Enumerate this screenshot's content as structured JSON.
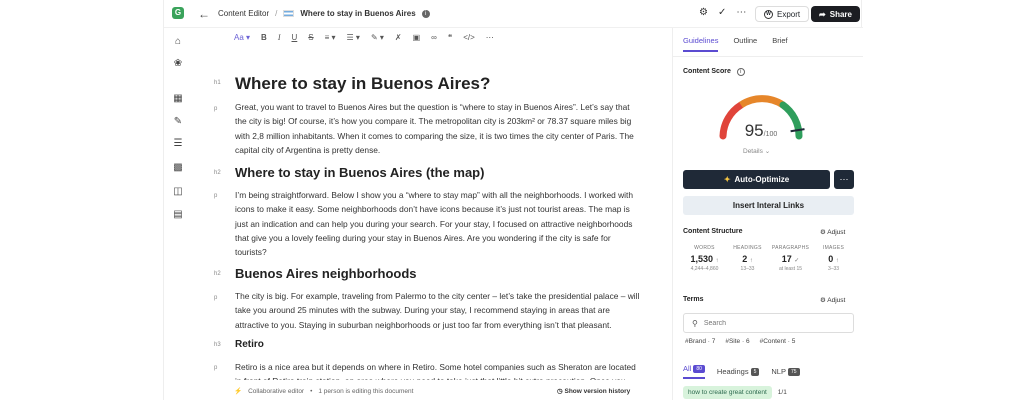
{
  "topbar": {
    "logo": "G",
    "breadcrumb_parent": "Content Editor",
    "breadcrumb_sep": "/",
    "doc_title": "Where to stay in Buenos Aires",
    "export_label": "Export",
    "share_label": "Share"
  },
  "toolbar": {
    "font_label": "Aa"
  },
  "editor": {
    "blocks": [
      {
        "tag": "h1",
        "text": "Where to stay in Buenos Aires?"
      },
      {
        "tag": "p",
        "text": "Great, you want to travel to Buenos Aires but the question is “where to stay in Buenos Aires”. Let’s say that the city is big! Of course, it’s how you compare it. The metropolitan city is 203km² or 78.37 square miles big with 2,8 million inhabitants. When it comes to comparing the size, it is two times the city center of Paris. The capital city of Argentina is pretty dense."
      },
      {
        "tag": "h2",
        "text": "Where to stay in Buenos Aires (the map)"
      },
      {
        "tag": "p",
        "text": "I’m being straightforward. Below I show you a “where to stay map” with all the neighborhoods. I worked with icons to make it easy. Some neighborhoods don’t have icons because it’s just not tourist areas. The map is just an indication and can help you during your search. For your stay, I focused on attractive neighborhoods that give you a lovely feeling during your stay in Buenos Aires. Are you wondering if the city is safe for tourists?"
      },
      {
        "tag": "h2",
        "text": "Buenos Aires neighborhoods"
      },
      {
        "tag": "p",
        "text": "The city is big. For example, traveling from Palermo to the city center – let’s take the presidential palace – will take you around 25 minutes with the subway. During your stay, I recommend staying in areas that are attractive to you. Staying in suburban neighborhoods or just too far from everything isn’t that pleasant."
      },
      {
        "tag": "h3",
        "text": "Retiro"
      },
      {
        "tag": "p",
        "text": "Retiro is a nice area but it depends on where in Retiro. Some hotel companies such as Sheraton are located in front of Retiro train station, an area where you need to take just that little bit extra precaution. Once you"
      }
    ],
    "status_left": "Collaborative editor",
    "status_dot": "•",
    "status_editing": "1 person is editing this document",
    "version_history": "Show version history"
  },
  "panel": {
    "tabs": [
      "Guidelines",
      "Outline",
      "Brief"
    ],
    "content_score_title": "Content Score",
    "score": "95",
    "score_max": "/100",
    "score_fraction": 0.95,
    "details_label": "Details",
    "auto_optimize_label": "Auto-Optimize",
    "internal_links_label": "Insert Interal Links",
    "content_structure_title": "Content Structure",
    "adjust_label": "Adjust",
    "stats": [
      {
        "label": "WORDS",
        "value": "1,530",
        "mark": "↑",
        "range": "4,244–4,860"
      },
      {
        "label": "HEADINGS",
        "value": "2",
        "mark": "↑",
        "range": "13–33"
      },
      {
        "label": "PARAGRAPHS",
        "value": "17",
        "mark": "✓",
        "range": "at least 15"
      },
      {
        "label": "IMAGES",
        "value": "0",
        "mark": "↑",
        "range": "3–33"
      }
    ],
    "terms_title": "Terms",
    "search_placeholder": "Search",
    "term_tags": [
      "#Brand · 7",
      "#Site · 6",
      "#Content · 5"
    ],
    "filters": [
      {
        "label": "All",
        "count": "80"
      },
      {
        "label": "Headings",
        "count": "5"
      },
      {
        "label": "NLP",
        "count": "75"
      }
    ],
    "keyword": "how to create great content",
    "keyword_fraction": "1/1"
  },
  "colors": {
    "accent": "#5b4bd1",
    "gauge_red": "#e0443a",
    "gauge_orange": "#e6862a",
    "gauge_green": "#2f9e5c",
    "primary_button": "#1f2937"
  }
}
